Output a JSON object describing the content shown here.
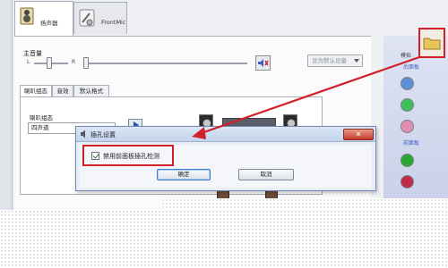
{
  "device_tabs": [
    {
      "label": "扬声器",
      "active": true
    },
    {
      "label": "FrontMic",
      "active": false
    }
  ],
  "main_volume": {
    "label": "主音量",
    "left": "L",
    "right": "R",
    "balance": 0.5,
    "level": 0.05
  },
  "set_default_button": {
    "label": "设为默认设备"
  },
  "sub_tabs": [
    {
      "label": "喇叭组态"
    },
    {
      "label": "音效"
    },
    {
      "label": "默认格式"
    }
  ],
  "speaker_config": {
    "label": "喇叭组态",
    "value": "四声道"
  },
  "jack_panel": {
    "top_label": "模拟",
    "rear_label": "后面板",
    "front_label": "前面板"
  },
  "jack_colors": {
    "front": [
      "#5b8fd8",
      "#3fbf5a",
      "#e08fb0"
    ],
    "rear": [
      "#26a832",
      "#c02b4a"
    ]
  },
  "dialog": {
    "title": "插孔设置",
    "close_label": "✕",
    "checkbox_label": "禁用前面板插孔检测",
    "checkbox_checked": true,
    "ok_label": "确定",
    "cancel_label": "取消"
  },
  "highlight_color": "#d0202a"
}
